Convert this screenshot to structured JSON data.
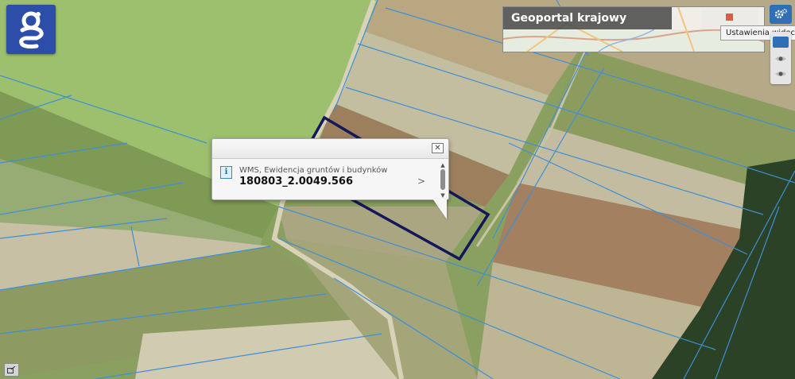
{
  "logo": {
    "letter": "g",
    "icon": "geoportal-logo-icon"
  },
  "overview": {
    "title": "Geoportal krajowy"
  },
  "settings": {
    "icon": "gear-icon",
    "tooltip": "Ustawienia widoczności"
  },
  "side_panel": {
    "icons": [
      "layer-visibility-icon",
      "eye-icon",
      "eye-icon"
    ]
  },
  "popup": {
    "layer_name": "WMS, Ewidencja gruntów i budynków",
    "parcel_id": "180803_2.0049.566",
    "info_icon_label": "i",
    "close_icon": "close-icon",
    "arrow_label": ">"
  },
  "colors": {
    "parcel_outline": "#14175a",
    "parcel_boundaries": "#3e8fd6",
    "accent": "#2f6fb5"
  }
}
